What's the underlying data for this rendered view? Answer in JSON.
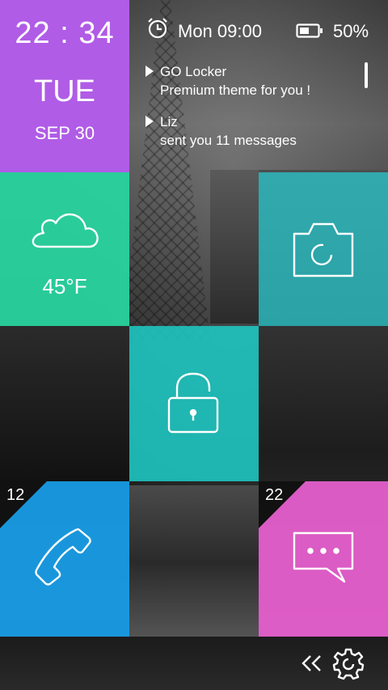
{
  "lock": {
    "clock": {
      "hour": "22",
      "sep": ":",
      "minute": "34"
    },
    "day": "TUE",
    "date": "SEP 30"
  },
  "status_bar": {
    "alarm_icon": "alarm-clock-icon",
    "alarm_time": "Mon 09:00",
    "battery_icon": "battery-icon",
    "battery_level": "50%"
  },
  "notifications": [
    {
      "title": "GO Locker",
      "body": "Premium theme for you !"
    },
    {
      "title": "Liz",
      "body": "sent you 11 messages"
    }
  ],
  "tiles": {
    "weather": {
      "icon": "cloud-icon",
      "temperature": "45°F",
      "color": "#28d6a0"
    },
    "camera": {
      "icon": "camera-icon",
      "color": "#28c8cd"
    },
    "unlock": {
      "icon": "unlocked-padlock-icon",
      "color": "#1ec8c3"
    },
    "phone": {
      "icon": "phone-icon",
      "badge": "12",
      "color": "#189ee8"
    },
    "messages": {
      "icon": "chat-bubble-icon",
      "badge": "22",
      "color": "#e860d0"
    },
    "time_color": "#b05ce6"
  },
  "bottom_bar": {
    "collapse_icon": "double-chevron-left-icon",
    "settings_icon": "settings-gear-icon"
  }
}
